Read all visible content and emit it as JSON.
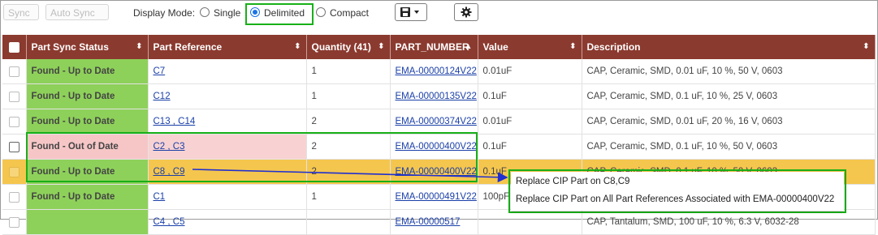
{
  "toolbar": {
    "sync_label": "Sync",
    "auto_sync_label": "Auto Sync",
    "display_mode_label": "Display Mode:",
    "modes": [
      {
        "label": "Single",
        "selected": false
      },
      {
        "label": "Delimited",
        "selected": true
      },
      {
        "label": "Compact",
        "selected": false
      }
    ],
    "save_icon": "save-icon",
    "settings_icon": "gear-icon"
  },
  "table": {
    "headers": {
      "status": "Part Sync Status",
      "reference": "Part Reference",
      "quantity": "Quantity (41)",
      "part_number": "PART_NUMBER",
      "value": "Value",
      "description": "Description"
    },
    "rows": [
      {
        "status": "Found - Up to Date",
        "reference": "C7",
        "quantity": "1",
        "part_number": "EMA-00000124V22",
        "value": "0.01uF",
        "description": "CAP, Ceramic, SMD, 0.01 uF, 10 %, 50 V, 0603"
      },
      {
        "status": "Found - Up to Date",
        "reference": "C12",
        "quantity": "1",
        "part_number": "EMA-00000135V22",
        "value": "0.1uF",
        "description": "CAP, Ceramic, SMD, 0.1 uF, 10 %, 25 V, 0603"
      },
      {
        "status": "Found - Up to Date",
        "reference": "C13 , C14",
        "quantity": "2",
        "part_number": "EMA-00000374V22",
        "value": "0.01uF",
        "description": "CAP, Ceramic, SMD, 0.01 uF, 20 %, 16 V, 0603"
      },
      {
        "status": "Found - Out of Date",
        "reference": "C2 , C3",
        "quantity": "2",
        "part_number": "EMA-00000400V22",
        "value": "0.1uF",
        "description": "CAP, Ceramic, SMD, 0.1 uF, 10 %, 50 V, 0603"
      },
      {
        "status": "Found - Up to Date",
        "reference": "C8 , C9",
        "quantity": "2",
        "part_number": "EMA-00000400V22",
        "value": "0.1uF",
        "description": "CAP, Ceramic, SMD, 0.1 uF, 10 %, 50 V, 0603"
      },
      {
        "status": "Found - Up to Date",
        "reference": "C1",
        "quantity": "1",
        "part_number": "EMA-00000491V22",
        "value": "100pF",
        "description": ""
      },
      {
        "status": "",
        "reference": "C4 , C5",
        "quantity": "",
        "part_number": "EMA-00000517",
        "value": "",
        "description": "CAP, Tantalum, SMD, 100 uF, 10 %, 6.3 V, 6032-28"
      }
    ]
  },
  "context_menu": {
    "items": [
      "Replace CIP Part on C8,C9",
      "Replace CIP Part on All Part References Associated with EMA-00000400V22"
    ]
  },
  "colors": {
    "header_bg": "#8b3a2f",
    "status_ok": "#8ed15a",
    "status_bad": "#f6c6c6",
    "selected_row": "#f5c64e",
    "highlight": "#18b018",
    "arrow": "#1f2fd0"
  }
}
